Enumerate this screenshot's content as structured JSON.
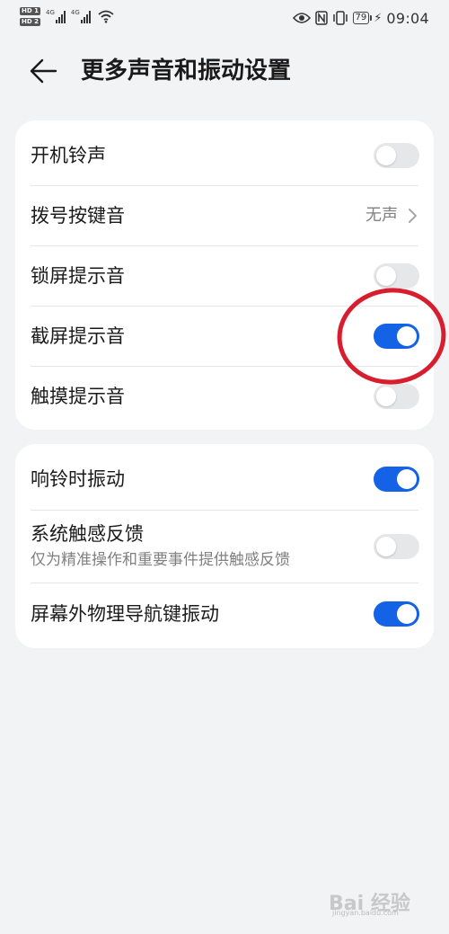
{
  "status_bar": {
    "hd1": "HD 1",
    "hd2": "HD 2",
    "net1": "4G",
    "net2": "4G",
    "battery": "79",
    "time": "09:04",
    "icons": [
      "hd-badge-icon",
      "signal-icon",
      "wifi-icon",
      "eye-icon",
      "nfc-icon",
      "vibrate-icon",
      "battery-icon",
      "charging-icon"
    ]
  },
  "header": {
    "title": "更多声音和振动设置",
    "back_icon": "arrow-left-icon"
  },
  "group1": {
    "items": [
      {
        "label": "开机铃声",
        "type": "toggle",
        "on": false
      },
      {
        "label": "拨号按键音",
        "type": "value",
        "value": "无声"
      },
      {
        "label": "锁屏提示音",
        "type": "toggle",
        "on": false
      },
      {
        "label": "截屏提示音",
        "type": "toggle",
        "on": true
      },
      {
        "label": "触摸提示音",
        "type": "toggle",
        "on": false
      }
    ]
  },
  "group2": {
    "items": [
      {
        "label": "响铃时振动",
        "type": "toggle",
        "on": true
      },
      {
        "label": "系统触感反馈",
        "subtitle": "仅为精准操作和重要事件提供触感反馈",
        "type": "toggle",
        "on": false
      },
      {
        "label": "屏幕外物理导航键振动",
        "type": "toggle",
        "on": true
      }
    ]
  },
  "annotation": {
    "shape": "circle",
    "color": "#d81e2e"
  },
  "watermark": {
    "text": "Bai  经验",
    "url": "jingyan.baidu.com"
  },
  "colors": {
    "background": "#f1f3f5",
    "card": "#ffffff",
    "toggle_on": "#1462e6",
    "toggle_off": "#e6e7e8"
  }
}
